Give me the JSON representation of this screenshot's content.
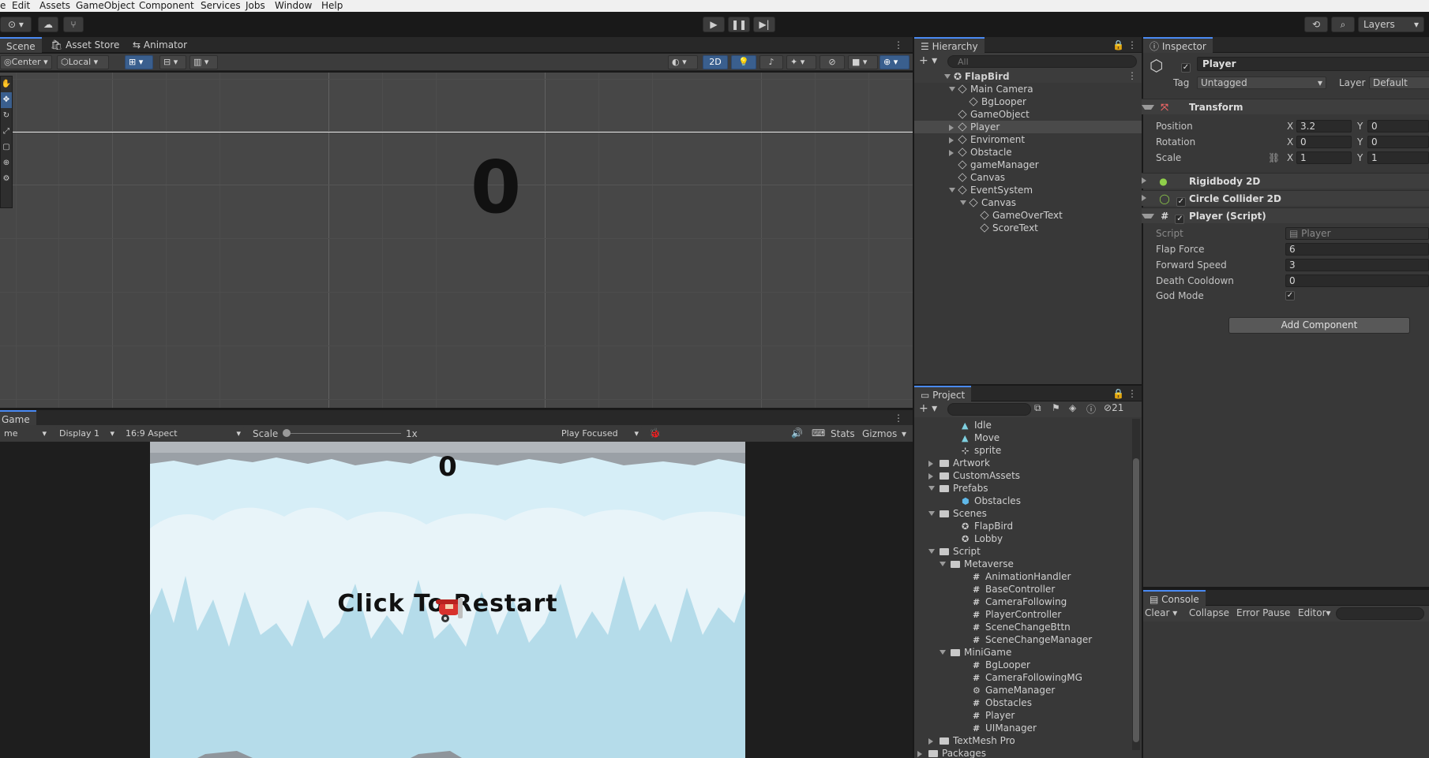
{
  "menu": [
    "Edit",
    "Assets",
    "GameObject",
    "Component",
    "Services",
    "Jobs",
    "Window",
    "Help"
  ],
  "toolbar": {
    "layers": "Layers"
  },
  "scene": {
    "tabs": [
      "Scene",
      "Asset Store",
      "Animator"
    ],
    "pivot": "Center",
    "space": "Local",
    "mode2d": "2D",
    "score_overlay": "0"
  },
  "game": {
    "tab": "Game",
    "left_dropdown": "me",
    "display": "Display 1",
    "aspect": "16:9 Aspect",
    "scale_label": "Scale",
    "scale_value": "1x",
    "play_focused": "Play Focused",
    "stats": "Stats",
    "gizmos": "Gizmos",
    "score": "0",
    "restart_text": "Click To Restart"
  },
  "hierarchy": {
    "title": "Hierarchy",
    "search_placeholder": "All",
    "root": "FlapBird",
    "items": [
      {
        "label": "Main Camera",
        "depth": 1,
        "arrow": "down"
      },
      {
        "label": "BgLooper",
        "depth": 2,
        "arrow": ""
      },
      {
        "label": "GameObject",
        "depth": 1,
        "arrow": ""
      },
      {
        "label": "Player",
        "depth": 1,
        "arrow": "right",
        "selected": true
      },
      {
        "label": "Enviroment",
        "depth": 1,
        "arrow": "right"
      },
      {
        "label": "Obstacle",
        "depth": 1,
        "arrow": "right"
      },
      {
        "label": "gameManager",
        "depth": 1,
        "arrow": ""
      },
      {
        "label": "Canvas",
        "depth": 1,
        "arrow": ""
      },
      {
        "label": "EventSystem",
        "depth": 1,
        "arrow": "down"
      },
      {
        "label": "Canvas",
        "depth": 2,
        "arrow": "down"
      },
      {
        "label": "GameOverText",
        "depth": 3,
        "arrow": ""
      },
      {
        "label": "ScoreText",
        "depth": 3,
        "arrow": ""
      }
    ]
  },
  "inspector": {
    "title": "Inspector",
    "object_name": "Player",
    "tag_label": "Tag",
    "tag_value": "Untagged",
    "layer_label": "Layer",
    "layer_value": "Default",
    "transform": {
      "title": "Transform",
      "position_label": "Position",
      "pos_x": "3.2",
      "pos_y": "0",
      "rotation_label": "Rotation",
      "rot_x": "0",
      "rot_y": "0",
      "scale_label": "Scale",
      "scale_x": "1",
      "scale_y": "1",
      "x": "X",
      "y": "Y"
    },
    "rigidbody": "Rigidbody 2D",
    "collider": "Circle Collider 2D",
    "script_comp": "Player (Script)",
    "script_label": "Script",
    "script_value": "Player",
    "flap_force_label": "Flap Force",
    "flap_force": "6",
    "forward_speed_label": "Forward Speed",
    "forward_speed": "3",
    "death_cooldown_label": "Death Cooldown",
    "death_cooldown": "0",
    "god_mode_label": "God Mode",
    "add_component": "Add Component"
  },
  "project": {
    "title": "Project",
    "hidden_count": "21",
    "items": [
      {
        "label": "Idle",
        "type": "anim",
        "indent": 3
      },
      {
        "label": "Move",
        "type": "anim",
        "indent": 3
      },
      {
        "label": "sprite",
        "type": "sprite",
        "indent": 3
      },
      {
        "label": "Artwork",
        "type": "folder",
        "indent": 1,
        "arrow": "right"
      },
      {
        "label": "CustomAssets",
        "type": "folder",
        "indent": 1,
        "arrow": "right"
      },
      {
        "label": "Prefabs",
        "type": "folder",
        "indent": 1,
        "arrow": "down"
      },
      {
        "label": "Obstacles",
        "type": "prefab",
        "indent": 3
      },
      {
        "label": "Scenes",
        "type": "folder",
        "indent": 1,
        "arrow": "down"
      },
      {
        "label": "FlapBird",
        "type": "scene",
        "indent": 3
      },
      {
        "label": "Lobby",
        "type": "scene",
        "indent": 3
      },
      {
        "label": "Script",
        "type": "folder",
        "indent": 1,
        "arrow": "down"
      },
      {
        "label": "Metaverse",
        "type": "folder",
        "indent": 2,
        "arrow": "down"
      },
      {
        "label": "AnimationHandler",
        "type": "script",
        "indent": 4
      },
      {
        "label": "BaseController",
        "type": "script",
        "indent": 4
      },
      {
        "label": "CameraFollowing",
        "type": "script",
        "indent": 4
      },
      {
        "label": "PlayerController",
        "type": "script",
        "indent": 4
      },
      {
        "label": "SceneChangeBttn",
        "type": "script",
        "indent": 4
      },
      {
        "label": "SceneChangeManager",
        "type": "script",
        "indent": 4
      },
      {
        "label": "MiniGame",
        "type": "folder",
        "indent": 2,
        "arrow": "down"
      },
      {
        "label": "BgLooper",
        "type": "script",
        "indent": 4
      },
      {
        "label": "CameraFollowingMG",
        "type": "script",
        "indent": 4
      },
      {
        "label": "GameManager",
        "type": "gear",
        "indent": 4
      },
      {
        "label": "Obstacles",
        "type": "script",
        "indent": 4
      },
      {
        "label": "Player",
        "type": "script",
        "indent": 4
      },
      {
        "label": "UIManager",
        "type": "script",
        "indent": 4
      },
      {
        "label": "TextMesh Pro",
        "type": "folder",
        "indent": 1,
        "arrow": "right"
      },
      {
        "label": "Packages",
        "type": "folder",
        "indent": 0,
        "arrow": "right"
      }
    ]
  },
  "console": {
    "title": "Console",
    "clear": "Clear",
    "collapse": "Collapse",
    "error_pause": "Error Pause",
    "editor": "Editor"
  }
}
